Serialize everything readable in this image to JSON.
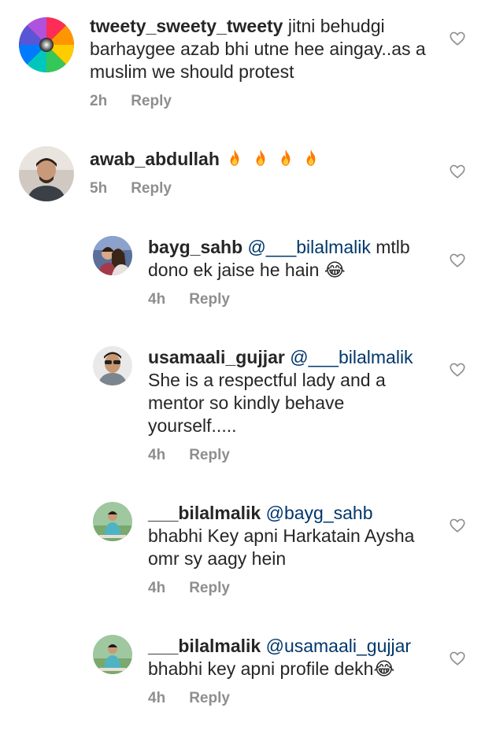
{
  "comments": [
    {
      "username": "tweety_sweety_tweety",
      "mention": "",
      "text": "jitni behudgi barhaygee azab bhi utne hee aingay..as a muslim we should protest",
      "time": "2h",
      "reply_label": "Reply",
      "avatar": "spiral-rainbow-avatar"
    },
    {
      "username": "awab_abdullah",
      "mention": "",
      "text": "🔥🔥🔥🔥",
      "time": "5h",
      "reply_label": "Reply",
      "avatar": "profile-photo-man"
    },
    {
      "username": "bayg_sahb",
      "mention": "@___bilalmalik",
      "text": "mtlb dono ek jaise he hain 😂",
      "time": "4h",
      "reply_label": "Reply",
      "avatar": "profile-photo-couple"
    },
    {
      "username": "usamaali_gujjar",
      "mention": "@___bilalmalik",
      "text": "She is a respectful lady and a mentor so kindly behave yourself.....",
      "time": "4h",
      "reply_label": "Reply",
      "avatar": "profile-photo-man-sunglasses"
    },
    {
      "username": "___bilalmalik",
      "mention": "@bayg_sahb",
      "text": "bhabhi Key apni Harkatain Aysha omr sy aagy hein",
      "time": "4h",
      "reply_label": "Reply",
      "avatar": "profile-photo-outdoor"
    },
    {
      "username": "___bilalmalik",
      "mention": "@usamaali_gujjar",
      "text": "bhabhi key apni profile dekh😂",
      "time": "4h",
      "reply_label": "Reply",
      "avatar": "profile-photo-outdoor"
    }
  ],
  "icons": {
    "like": "heart-outline-icon",
    "fire": "fire-emoji",
    "laugh": "tears-of-joy-emoji"
  },
  "colors": {
    "text": "#262626",
    "mention": "#00376b",
    "meta": "#8e8e8e",
    "heart_stroke": "#8e8e8e"
  }
}
